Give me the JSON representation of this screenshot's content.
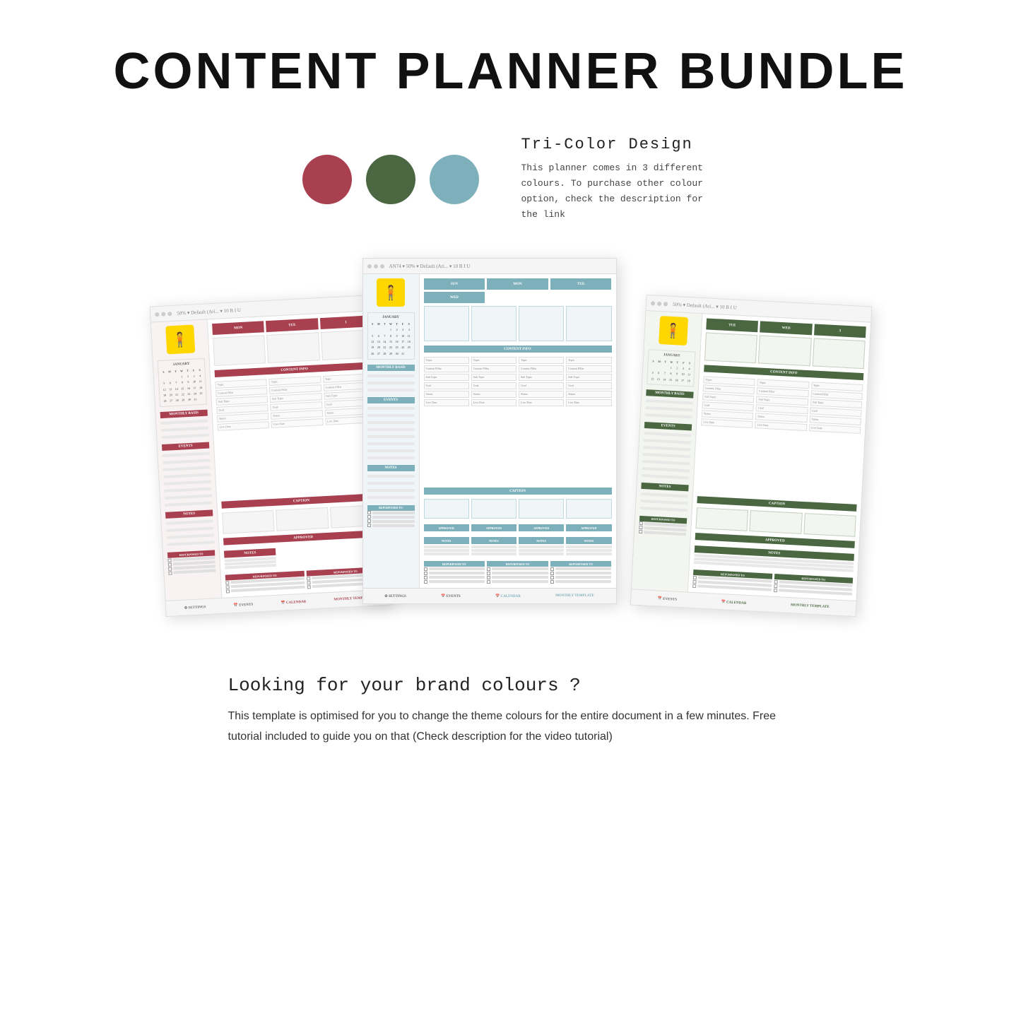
{
  "page": {
    "title": "CONTENT PLANNER BUNDLE",
    "color_section": {
      "heading": "Tri-Color Design",
      "description": "This planner comes in 3 different colours.\nTo purchase other colour option, check\nthe description for the link",
      "colors": [
        {
          "name": "red",
          "hex": "#a84050",
          "label": "Red"
        },
        {
          "name": "green",
          "hex": "#4a6741",
          "label": "Green"
        },
        {
          "name": "blue",
          "hex": "#7eb0bc",
          "label": "Blue"
        }
      ]
    },
    "planners": [
      {
        "id": "left",
        "color": "red",
        "accent": "#a84050",
        "tabs": [
          "SETTINGS",
          "EVENTS",
          "CALENDAR",
          "MONTHLY TEMPLATE"
        ]
      },
      {
        "id": "center",
        "color": "blue",
        "accent": "#7eb0bc",
        "tabs": [
          "SETTINGS",
          "EVENTS",
          "CALENDAR",
          "MONTHLY TEMPLATE"
        ]
      },
      {
        "id": "right",
        "color": "green",
        "accent": "#4a6741",
        "tabs": [
          "EVENTS",
          "CALENDAR",
          "MONTHLY TEMPLATE"
        ]
      }
    ],
    "bottom": {
      "title": "Looking for your brand colours ?",
      "description": "This template is optimised for you to change the theme colours for the entire document in a few minutes. Free tutorial included to guide you on that (Check description for the video tutorial)"
    }
  }
}
